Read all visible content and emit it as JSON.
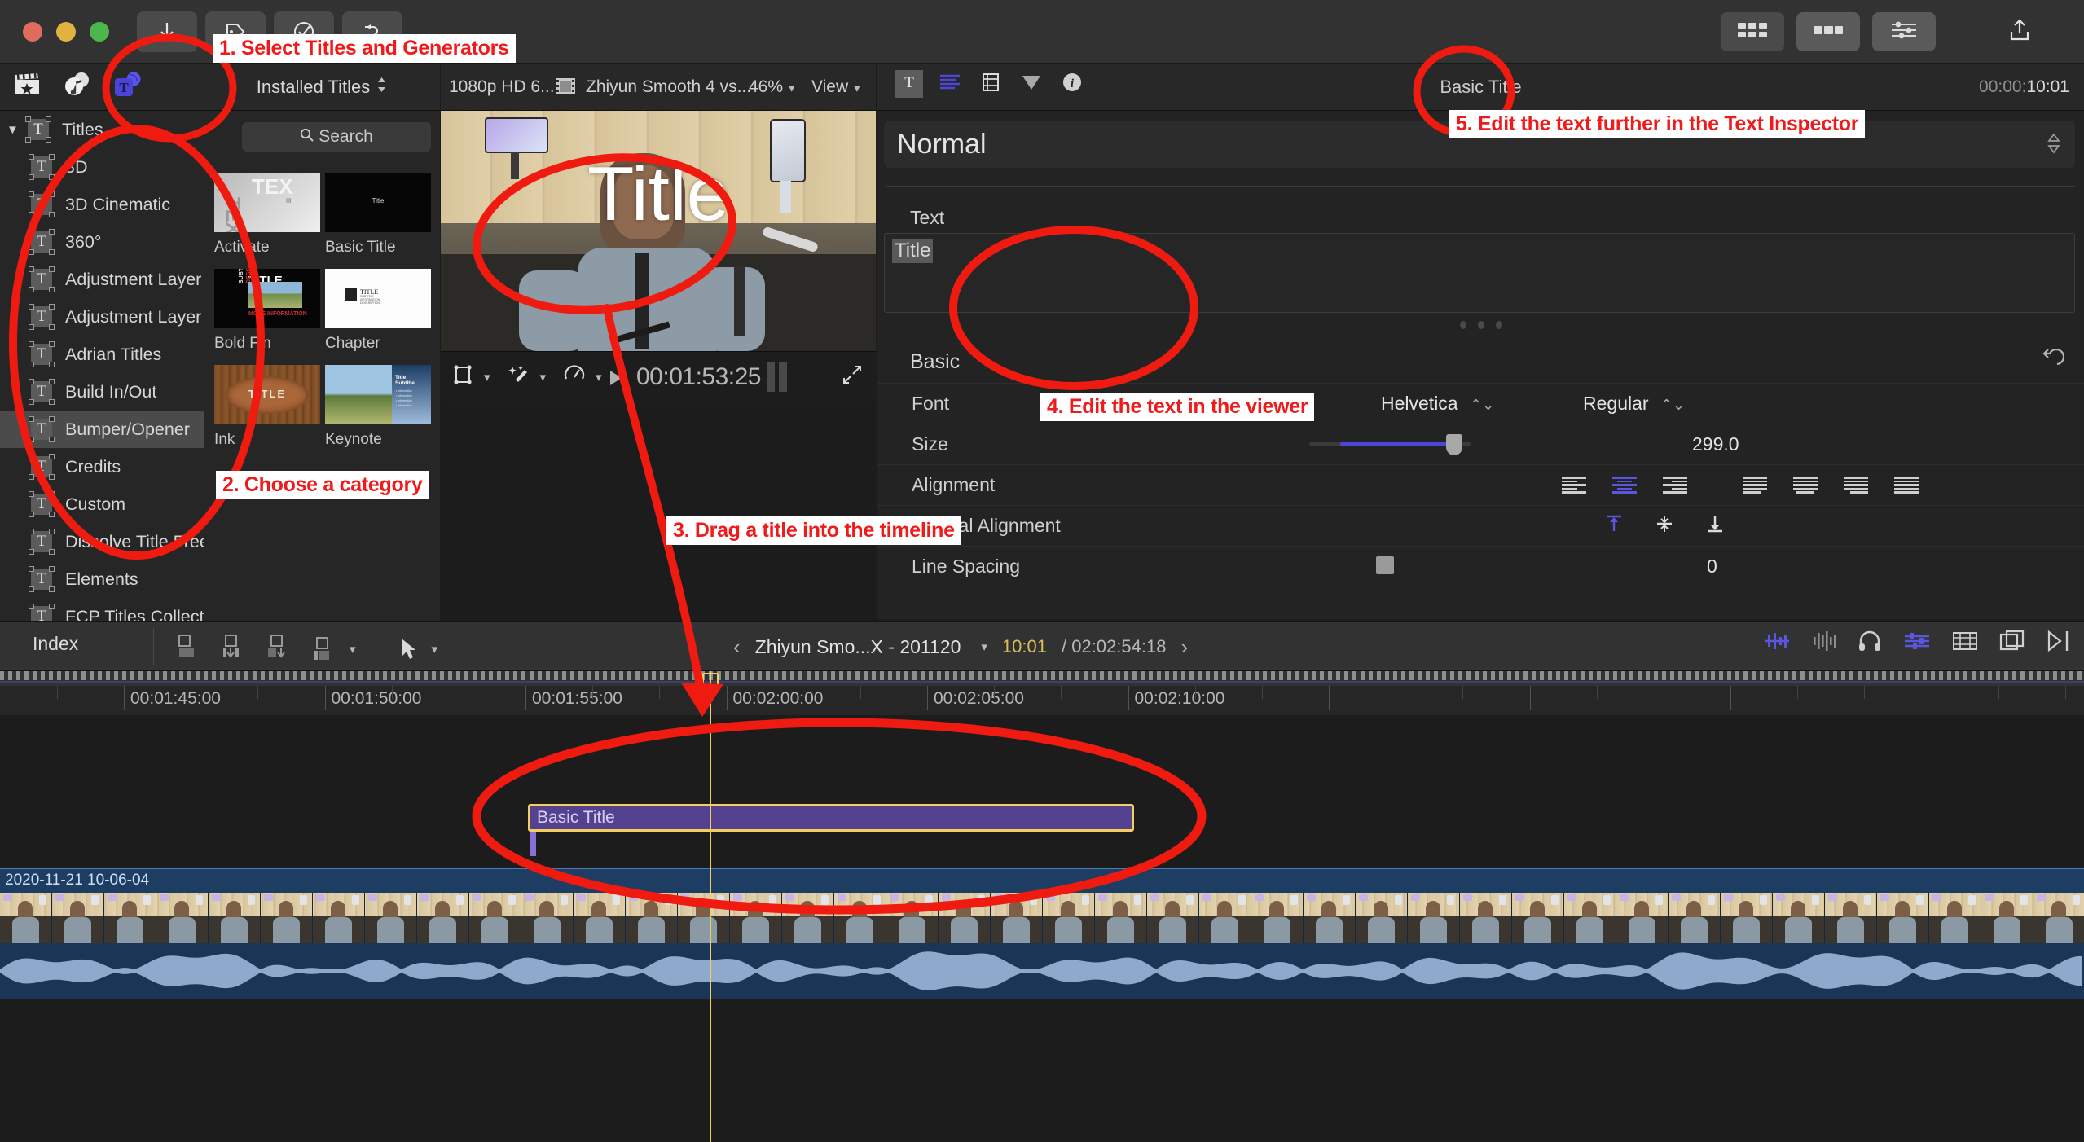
{
  "window": {
    "traffic_lights": [
      "close",
      "minimize",
      "zoom"
    ],
    "toolbar_left_icons": [
      "import-media-icon",
      "keyword-icon",
      "check-icon",
      "retime-icon"
    ],
    "toolbar_right_icons": [
      "browser-toggle-icon",
      "timeline-toggle-icon",
      "inspector-toggle-icon",
      "share-icon"
    ]
  },
  "browser": {
    "tabs": [
      "photos-audio-icon",
      "music-icon",
      "titles-generators-icon"
    ],
    "active_tab": "titles-generators-icon",
    "installed_label": "Installed Titles",
    "search_placeholder": "Search",
    "sidebar": {
      "root": "Titles",
      "items": [
        "3D",
        "3D Cinematic",
        "360°",
        "Adjustment Layer",
        "Adjustment Layer - I Mot",
        "Adrian Titles",
        "Build In/Out",
        "Bumper/Opener",
        "Credits",
        "Custom",
        "Dissolve Title Free",
        "Elements",
        "FCP Titles Collection"
      ],
      "selected": "Bumper/Opener"
    },
    "thumbnails": [
      {
        "label": "Activate",
        "style": "activate"
      },
      {
        "label": "Basic Title",
        "style": "basic"
      },
      {
        "label": "Bold Fin",
        "style": "boldfin"
      },
      {
        "label": "Chapter",
        "style": "chapter"
      },
      {
        "label": "Ink",
        "style": "ink"
      },
      {
        "label": "Keynote",
        "style": "keynote"
      }
    ]
  },
  "viewer": {
    "resolution": "1080p HD 6...",
    "clip_name": "Zhiyun Smooth 4 vs...",
    "zoom": "46%",
    "view_menu": "View",
    "overlay_text": "Title",
    "timecode": "00:01:53:25",
    "tool_icons": [
      "transform-icon",
      "enhance-icon",
      "retime-icon"
    ],
    "play_icon": "play-icon",
    "expand_icon": "expand-icon"
  },
  "inspector": {
    "tabs": [
      "text-inspector-icon",
      "title-inspector-icon",
      "video-inspector-icon",
      "color-inspector-icon",
      "info-inspector-icon"
    ],
    "active_tab": "text-inspector-icon",
    "title": "Basic Title",
    "duration_prefix": "00:00:",
    "duration_main": "10:01",
    "blend_mode": "Normal",
    "text_label": "Text",
    "text_value": "Title",
    "section": {
      "name": "Basic",
      "reset_icon": "reset-icon"
    },
    "properties": {
      "font_label": "Font",
      "font_family": "Helvetica",
      "font_style": "Regular",
      "size_label": "Size",
      "size_value": "299.0",
      "alignment_label": "Alignment",
      "alignment_selected_index": 1,
      "vertical_alignment_label": "Vertical Alignment",
      "vertical_alignment_selected_index": 0,
      "line_spacing_label": "Line Spacing",
      "line_spacing_value": "0"
    },
    "accent_color": "#4c47d6"
  },
  "timeline": {
    "index_label": "Index",
    "project_name": "Zhiyun Smo...X - 201120",
    "current_timecode": "10:01",
    "total_timecode": "02:02:54:18",
    "ruler_labels": [
      "00:01:45:00",
      "00:01:50:00",
      "00:01:55:00",
      "00:02:00:00",
      "00:02:05:00",
      "00:02:10:00"
    ],
    "title_clip_label": "Basic Title",
    "video_clip_label": "2020-11-21 10-06-04",
    "tool_icons": [
      "append-icon",
      "insert-icon",
      "overwrite-icon",
      "connect-icon",
      "select-tool-icon"
    ],
    "right_icons": [
      "audio-meter-icon",
      "waveform-icon",
      "headphone-icon",
      "audio-mix-icon",
      "filmstrip-icon",
      "window-icon",
      "close-panel-icon"
    ]
  },
  "annotations": [
    {
      "id": "step1",
      "text": "1. Select Titles and Generators"
    },
    {
      "id": "step2",
      "text": "2. Choose a category"
    },
    {
      "id": "step3",
      "text": "3. Drag a title into the timeline"
    },
    {
      "id": "step4",
      "text": "4. Edit the text in the viewer"
    },
    {
      "id": "step5",
      "text": "5. Edit the text further in the Text Inspector"
    }
  ],
  "colors": {
    "annotation_red": "#ef1a1a",
    "annotation_bg": "#ffffff",
    "accent_blue": "#4c47d6",
    "clip_purple": "#54418f",
    "selection_yellow": "#f2cf5e",
    "video_blue": "#1e3d63"
  }
}
